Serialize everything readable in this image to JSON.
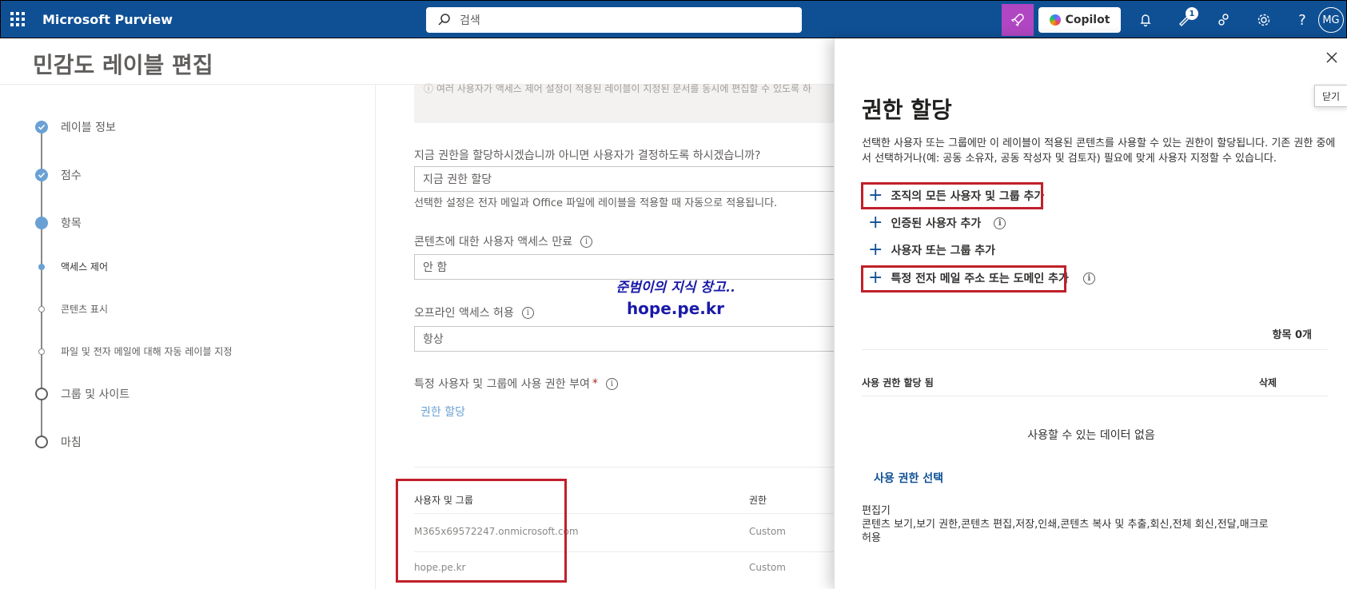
{
  "topbar": {
    "app_name": "Microsoft Purview",
    "search_placeholder": "검색",
    "copilot_label": "Copilot",
    "notification_count": "1",
    "avatar_initials": "MG"
  },
  "page": {
    "title": "민감도 레이블 편집"
  },
  "steps": [
    {
      "label": "레이블 정보",
      "state": "done"
    },
    {
      "label": "점수",
      "state": "done"
    },
    {
      "label": "항목",
      "state": "current"
    },
    {
      "label": "액세스 제어",
      "state": "sub-current"
    },
    {
      "label": "콘텐츠 표시",
      "state": "sub"
    },
    {
      "label": "파일 및 전자 메일에 대해 자동 레이블 지정",
      "state": "sub"
    },
    {
      "label": "그룹 및 사이트",
      "state": "todo"
    },
    {
      "label": "마침",
      "state": "todo"
    }
  ],
  "form": {
    "notice_text": "여러 사용자가 액세스 제어 설정이 적용된 레이블이 지정된 문서를 동시에 편집할 수 있도록 하",
    "q_assign": "지금 권한을 할당하시겠습니까 아니면 사용자가 결정하도록 하시겠습니까?",
    "assign_value": "지금 권한 할당",
    "assign_help": "선택한 설정은 전자 메일과 Office 파일에 레이블을 적용할 때 자동으로 적용됩니다.",
    "expiry_label": "콘텐츠에 대한 사용자 액세스 만료",
    "expiry_value": "안 함",
    "offline_label": "오프라인 액세스 허용",
    "offline_value": "항상",
    "grant_label": "특정 사용자 및 그룹에 사용 권한 부여",
    "grant_required": "*",
    "assign_link": "권한 할당"
  },
  "table": {
    "col_users": "사용자 및 그룹",
    "col_perm": "권한",
    "rows": [
      {
        "user": "M365x69572247.onmicrosoft.com",
        "perm": "Custom"
      },
      {
        "user": "hope.pe.kr",
        "perm": "Custom"
      }
    ]
  },
  "watermark": {
    "line1": "준범이의 지식 창고..",
    "line2": "hope.pe.kr"
  },
  "panel": {
    "close_tooltip": "닫기",
    "title": "권한 할당",
    "description": "선택한 사용자 또는 그룹에만 이 레이블이 적용된 콘텐츠를 사용할 수 있는 권한이 할당됩니다. 기존 권한 중에서 선택하거나(예: 공동 소유자, 공동 작성자 및 검토자) 필요에 맞게 사용자 지정할 수 있습니다.",
    "actions": [
      "조직의 모든 사용자 및 그룹 추가",
      "인증된 사용자 추가",
      "사용자 또는 그룹 추가",
      "특정 전자 메일 주소 또는 도메인 추가"
    ],
    "count_label": "항목 0개",
    "col_assigned": "사용 권한 할당 됨",
    "col_delete": "삭제",
    "no_data": "사용할 수 있는 데이터 없음",
    "choose_perm": "사용 권한 선택",
    "role_name": "편집기",
    "role_perms_1": "콘텐츠 보기,보기 권한,콘텐츠 편집,저장,인쇄,콘텐츠 복사 및 추출,회신,전체 회신,전달,매크로",
    "role_perms_2": "허용"
  },
  "colors": {
    "topbar": "#0f5095",
    "accent": "#6aa1d4",
    "highlight_box": "#c0202a",
    "copilot_button": "#b146c2"
  }
}
